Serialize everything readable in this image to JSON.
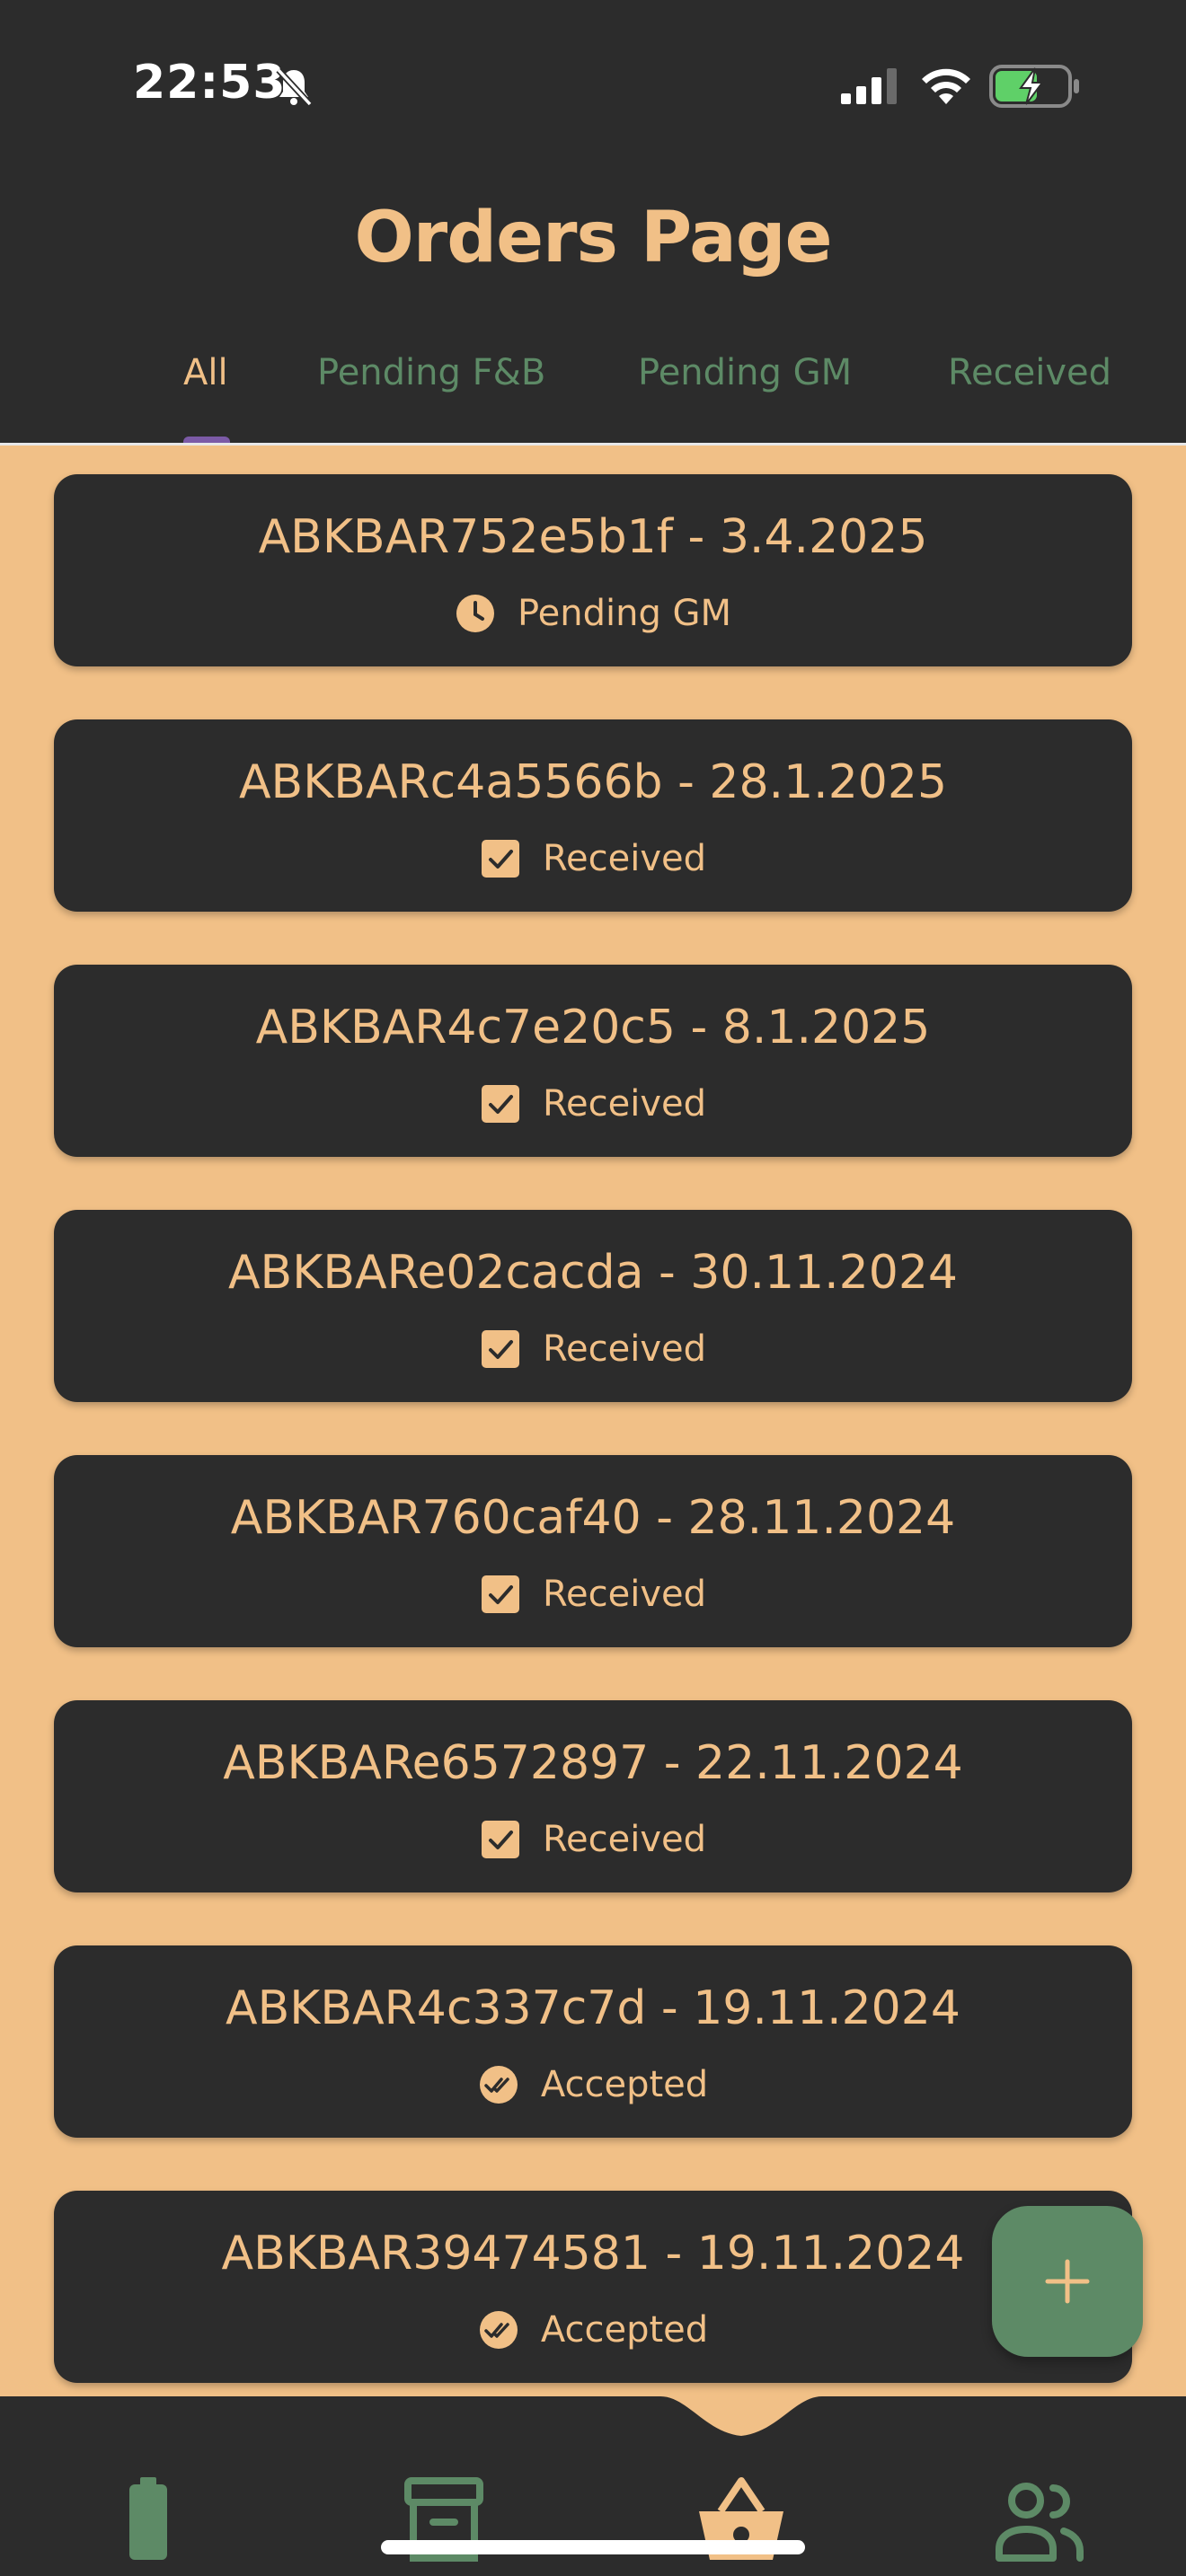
{
  "status_bar": {
    "time": "22:53",
    "icons": [
      "bell-off-icon",
      "signal-icon",
      "wifi-icon",
      "battery-charging-icon"
    ]
  },
  "header": {
    "title": "Orders Page"
  },
  "tabs": [
    {
      "label": "All",
      "active": true
    },
    {
      "label": "Pending F&B",
      "active": false
    },
    {
      "label": "Pending GM",
      "active": false
    },
    {
      "label": "Received",
      "active": false
    }
  ],
  "orders": [
    {
      "title": "ABKBAR752e5b1f - 3.4.2025",
      "status": "Pending GM",
      "icon": "clock-icon"
    },
    {
      "title": "ABKBARc4a5566b - 28.1.2025",
      "status": "Received",
      "icon": "checkbox-icon"
    },
    {
      "title": "ABKBAR4c7e20c5 - 8.1.2025",
      "status": "Received",
      "icon": "checkbox-icon"
    },
    {
      "title": "ABKBARe02cacda - 30.11.2024",
      "status": "Received",
      "icon": "checkbox-icon"
    },
    {
      "title": "ABKBAR760caf40 - 28.11.2024",
      "status": "Received",
      "icon": "checkbox-icon"
    },
    {
      "title": "ABKBARe6572897 - 22.11.2024",
      "status": "Received",
      "icon": "checkbox-icon"
    },
    {
      "title": "ABKBAR4c337c7d - 19.11.2024",
      "status": "Accepted",
      "icon": "double-check-icon"
    },
    {
      "title": "ABKBAR39474581 - 19.11.2024",
      "status": "Accepted",
      "icon": "double-check-icon"
    }
  ],
  "fab": {
    "icon": "plus-icon"
  },
  "bottom_nav": [
    {
      "icon": "battery-icon",
      "active": false
    },
    {
      "icon": "archive-icon",
      "active": false
    },
    {
      "icon": "basket-icon",
      "active": true
    },
    {
      "icon": "people-icon",
      "active": false
    }
  ],
  "colors": {
    "background": "#f1c087",
    "surface": "#2c2c2c",
    "accent": "#5d8a66",
    "text": "#f1c087",
    "indicator": "#7b5aa6"
  }
}
